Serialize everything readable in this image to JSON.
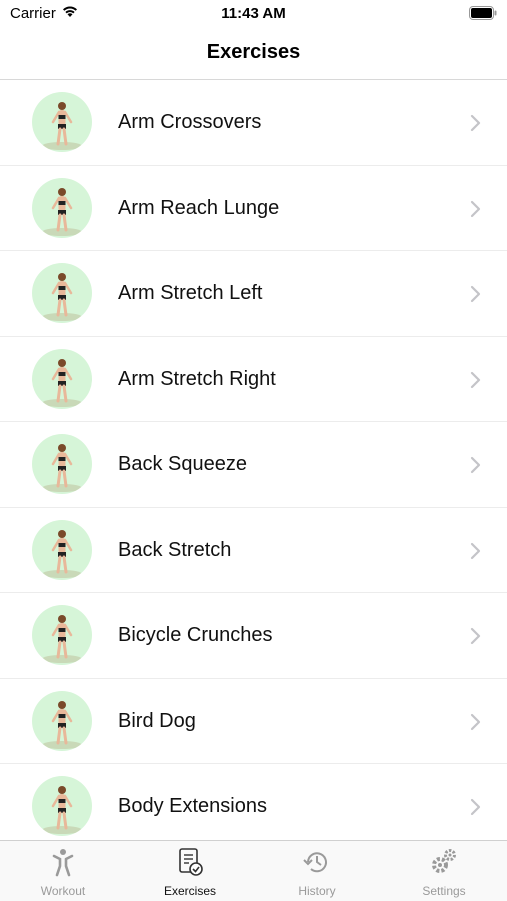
{
  "status_bar": {
    "carrier": "Carrier",
    "time": "11:43 AM"
  },
  "nav": {
    "title": "Exercises"
  },
  "exercises": [
    {
      "name": "Arm Crossovers"
    },
    {
      "name": "Arm Reach Lunge"
    },
    {
      "name": "Arm Stretch Left"
    },
    {
      "name": "Arm Stretch Right"
    },
    {
      "name": "Back Squeeze"
    },
    {
      "name": "Back Stretch"
    },
    {
      "name": "Bicycle Crunches"
    },
    {
      "name": "Bird Dog"
    },
    {
      "name": "Body Extensions"
    }
  ],
  "tabs": [
    {
      "label": "Workout",
      "icon": "workout-icon"
    },
    {
      "label": "Exercises",
      "icon": "exercises-icon"
    },
    {
      "label": "History",
      "icon": "history-icon"
    },
    {
      "label": "Settings",
      "icon": "settings-icon"
    }
  ],
  "colors": {
    "thumb_bg": "#d6f5d8",
    "chevron": "#c4c4c8",
    "tab_inactive": "#9a9a9a",
    "tab_active": "#111111"
  }
}
